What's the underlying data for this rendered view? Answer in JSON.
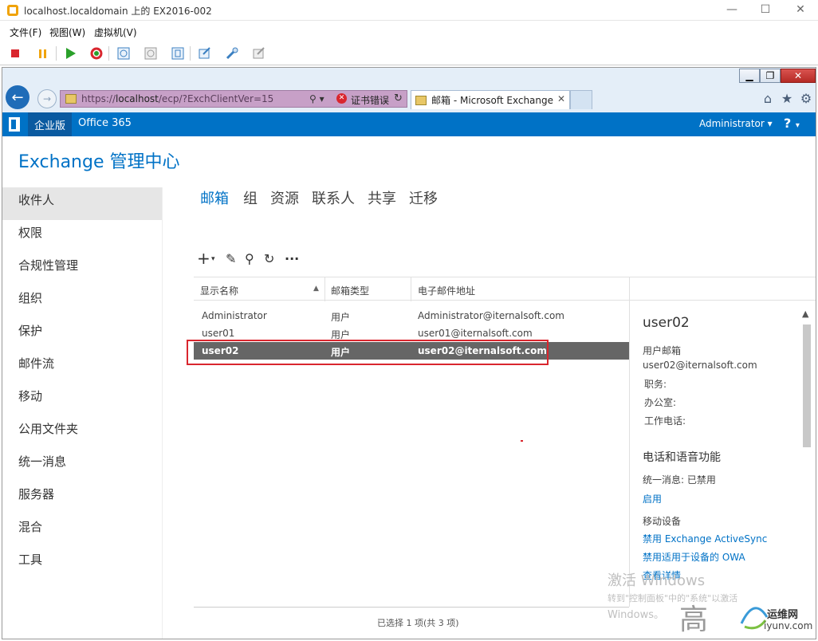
{
  "vm": {
    "title": "localhost.localdomain 上的 EX2016-002",
    "menu": [
      "文件(F)",
      "视图(W)",
      "虚拟机(V)"
    ]
  },
  "browser": {
    "url_prefix": "https://",
    "url_host": "localhost",
    "url_path": "/ecp/?ExchClientVer=15",
    "cert_error": "证书错误",
    "tab_label": "邮箱 - Microsoft Exchange"
  },
  "topbar": {
    "edition": "企业版",
    "office365": "Office 365",
    "user": "Administrator",
    "help": "?"
  },
  "app_title": "Exchange 管理中心",
  "nav": {
    "items": [
      "收件人",
      "权限",
      "合规性管理",
      "组织",
      "保护",
      "邮件流",
      "移动",
      "公用文件夹",
      "统一消息",
      "服务器",
      "混合",
      "工具"
    ]
  },
  "subtabs": [
    "邮箱",
    "组",
    "资源",
    "联系人",
    "共享",
    "迁移"
  ],
  "table": {
    "headers": [
      "显示名称",
      "邮箱类型",
      "电子邮件地址"
    ],
    "rows": [
      {
        "name": "Administrator",
        "type": "用户",
        "email": "Administrator@iternalsoft.com"
      },
      {
        "name": "user01",
        "type": "用户",
        "email": "user01@iternalsoft.com"
      },
      {
        "name": "user02",
        "type": "用户",
        "email": "user02@iternalsoft.com"
      }
    ],
    "status": "已选择 1 项(共 3 项)"
  },
  "details": {
    "name": "user02",
    "mailbox_label": "用户邮箱",
    "email": "user02@iternalsoft.com",
    "title_label": "职务:",
    "office_label": "办公室:",
    "phone_label": "工作电话:",
    "voice_section": "电话和语音功能",
    "um_status": "统一消息: 已禁用",
    "enable_link": "启用",
    "mobile_section": "移动设备",
    "disable_eas": "禁用 Exchange ActiveSync",
    "disable_owa": "禁用适用于设备的 OWA",
    "view_details": "查看详情"
  },
  "watermark": {
    "activate_title": "激活 Windows",
    "activate_line": "转到\"控制面板\"中的\"系统\"以激活",
    "activate_line2": "Windows。",
    "site_logo": "运维网",
    "site_url": "iyunv.com",
    "site_glyphs": "高"
  },
  "colors": {
    "accent": "#0072c6",
    "selection": "#666666",
    "highlight_box": "#d9262e"
  }
}
